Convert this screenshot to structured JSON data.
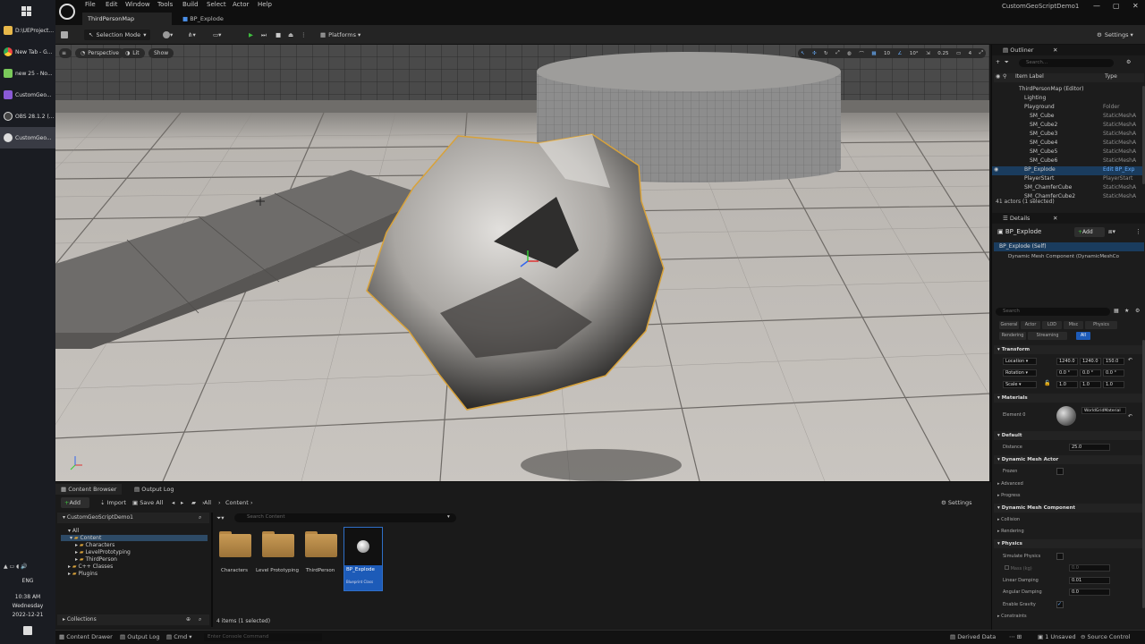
{
  "taskbar": {
    "items": [
      {
        "label": "D:\\UEProject...",
        "color": "#e8b84a"
      },
      {
        "label": "New Tab - G...",
        "color": "#4a8fe8"
      },
      {
        "label": "new 25 - No...",
        "color": "#7ac95a"
      },
      {
        "label": "CustomGeo...",
        "color": "#8a5ad6"
      },
      {
        "label": "OBS 28.1.2 (...",
        "color": "#444444"
      },
      {
        "label": "CustomGeo...",
        "color": "#dddddd"
      }
    ],
    "lang": "ENG",
    "time": "10:38 AM",
    "day": "Wednesday",
    "date": "2022-12-21"
  },
  "window": {
    "title": "CustomGeoScriptDemo1"
  },
  "menu": [
    "File",
    "Edit",
    "Window",
    "Tools",
    "Build",
    "Select",
    "Actor",
    "Help"
  ],
  "tabs": [
    {
      "label": "ThirdPersonMap",
      "active": true
    },
    {
      "label": "BP_Explode",
      "active": false
    }
  ],
  "toolbar": {
    "mode": "Selection Mode",
    "platforms": "Platforms",
    "settings": "Settings"
  },
  "viewport": {
    "perspective": "Perspective",
    "lit": "Lit",
    "show": "Show",
    "grid_snap": "10",
    "rot_snap": "10°",
    "scale_snap": "0.25",
    "cam_speed": "4"
  },
  "outliner": {
    "title": "Outliner",
    "search_placeholder": "Search...",
    "col_label": "Item Label",
    "col_type": "Type",
    "rows": [
      {
        "label": "ThirdPersonMap (Editor)",
        "type": "",
        "indent": 1,
        "selected": false
      },
      {
        "label": "Lighting",
        "type": "",
        "indent": 2,
        "selected": false
      },
      {
        "label": "Playground",
        "type": "Folder",
        "indent": 2,
        "selected": false
      },
      {
        "label": "SM_Cube",
        "type": "StaticMeshA",
        "indent": 3,
        "selected": false
      },
      {
        "label": "SM_Cube2",
        "type": "StaticMeshA",
        "indent": 3,
        "selected": false
      },
      {
        "label": "SM_Cube3",
        "type": "StaticMeshA",
        "indent": 3,
        "selected": false
      },
      {
        "label": "SM_Cube4",
        "type": "StaticMeshA",
        "indent": 3,
        "selected": false
      },
      {
        "label": "SM_Cube5",
        "type": "StaticMeshA",
        "indent": 3,
        "selected": false
      },
      {
        "label": "SM_Cube6",
        "type": "StaticMeshA",
        "indent": 3,
        "selected": false
      },
      {
        "label": "BP_Explode",
        "type": "Edit BP_Exp",
        "indent": 2,
        "selected": true
      },
      {
        "label": "PlayerStart",
        "type": "PlayerStart",
        "indent": 2,
        "selected": false
      },
      {
        "label": "SM_ChamferCube",
        "type": "StaticMeshA",
        "indent": 2,
        "selected": false
      },
      {
        "label": "SM_ChamferCube2",
        "type": "StaticMeshA",
        "indent": 2,
        "selected": false
      }
    ],
    "status": "41 actors (1 selected)"
  },
  "details": {
    "title": "Details",
    "actor": "BP_Explode",
    "add": "Add",
    "self": "BP_Explode (Self)",
    "component": "Dynamic Mesh Component (DynamicMeshCo",
    "search_placeholder": "Search",
    "filters": [
      "General",
      "Actor",
      "LOD",
      "Misc",
      "Physics",
      "Rendering",
      "Streaming",
      "All"
    ],
    "transform": {
      "section": "Transform",
      "location": {
        "label": "Location",
        "x": "1240.0",
        "y": "1240.0",
        "z": "150.0"
      },
      "rotation": {
        "label": "Rotation",
        "x": "0.0 °",
        "y": "0.0 °",
        "z": "0.0 °"
      },
      "scale": {
        "label": "Scale",
        "x": "1.0",
        "y": "1.0",
        "z": "1.0"
      }
    },
    "materials": {
      "section": "Materials",
      "element": "Element 0",
      "material": "WorldGridMaterial"
    },
    "default": {
      "section": "Default",
      "distance_label": "Distance",
      "distance": "25.0"
    },
    "dma": {
      "section": "Dynamic Mesh Actor",
      "frozen": "Frozen",
      "advanced": "Advanced",
      "progress": "Progress"
    },
    "dmc": {
      "section": "Dynamic Mesh Component",
      "collision": "Collision",
      "rendering": "Rendering"
    },
    "physics": {
      "section": "Physics",
      "simulate": "Simulate Physics",
      "mass_label": "Mass (kg)",
      "mass": "0.0",
      "linear_label": "Linear Damping",
      "linear": "0.01",
      "angular_label": "Angular Damping",
      "angular": "0.0",
      "gravity": "Enable Gravity",
      "constraints": "Constraints"
    }
  },
  "content_browser": {
    "tab": "Content Browser",
    "tab2": "Output Log",
    "add": "Add",
    "import": "Import",
    "save_all": "Save All",
    "crumb_all": "All",
    "crumb_content": "Content",
    "settings": "Settings",
    "project": "CustomGeoScriptDemo1",
    "search_placeholder": "Search Content",
    "tree": [
      "All",
      "Content",
      "Characters",
      "LevelPrototyping",
      "ThirdPerson",
      "C++ Classes",
      "Plugins"
    ],
    "assets": [
      {
        "label": "Characters",
        "kind": "folder"
      },
      {
        "label": "Level Prototyping",
        "kind": "folder"
      },
      {
        "label": "ThirdPerson",
        "kind": "folder"
      },
      {
        "label": "BP_Explode",
        "kind": "blueprint",
        "sub": "Blueprint Class"
      }
    ],
    "collections": "Collections",
    "count": "4 items (1 selected)"
  },
  "statusbar": {
    "content_drawer": "Content Drawer",
    "output_log": "Output Log",
    "cmd": "Cmd",
    "console_placeholder": "Enter Console Command",
    "derived": "Derived Data",
    "unsaved": "1 Unsaved",
    "source": "Source Control"
  }
}
